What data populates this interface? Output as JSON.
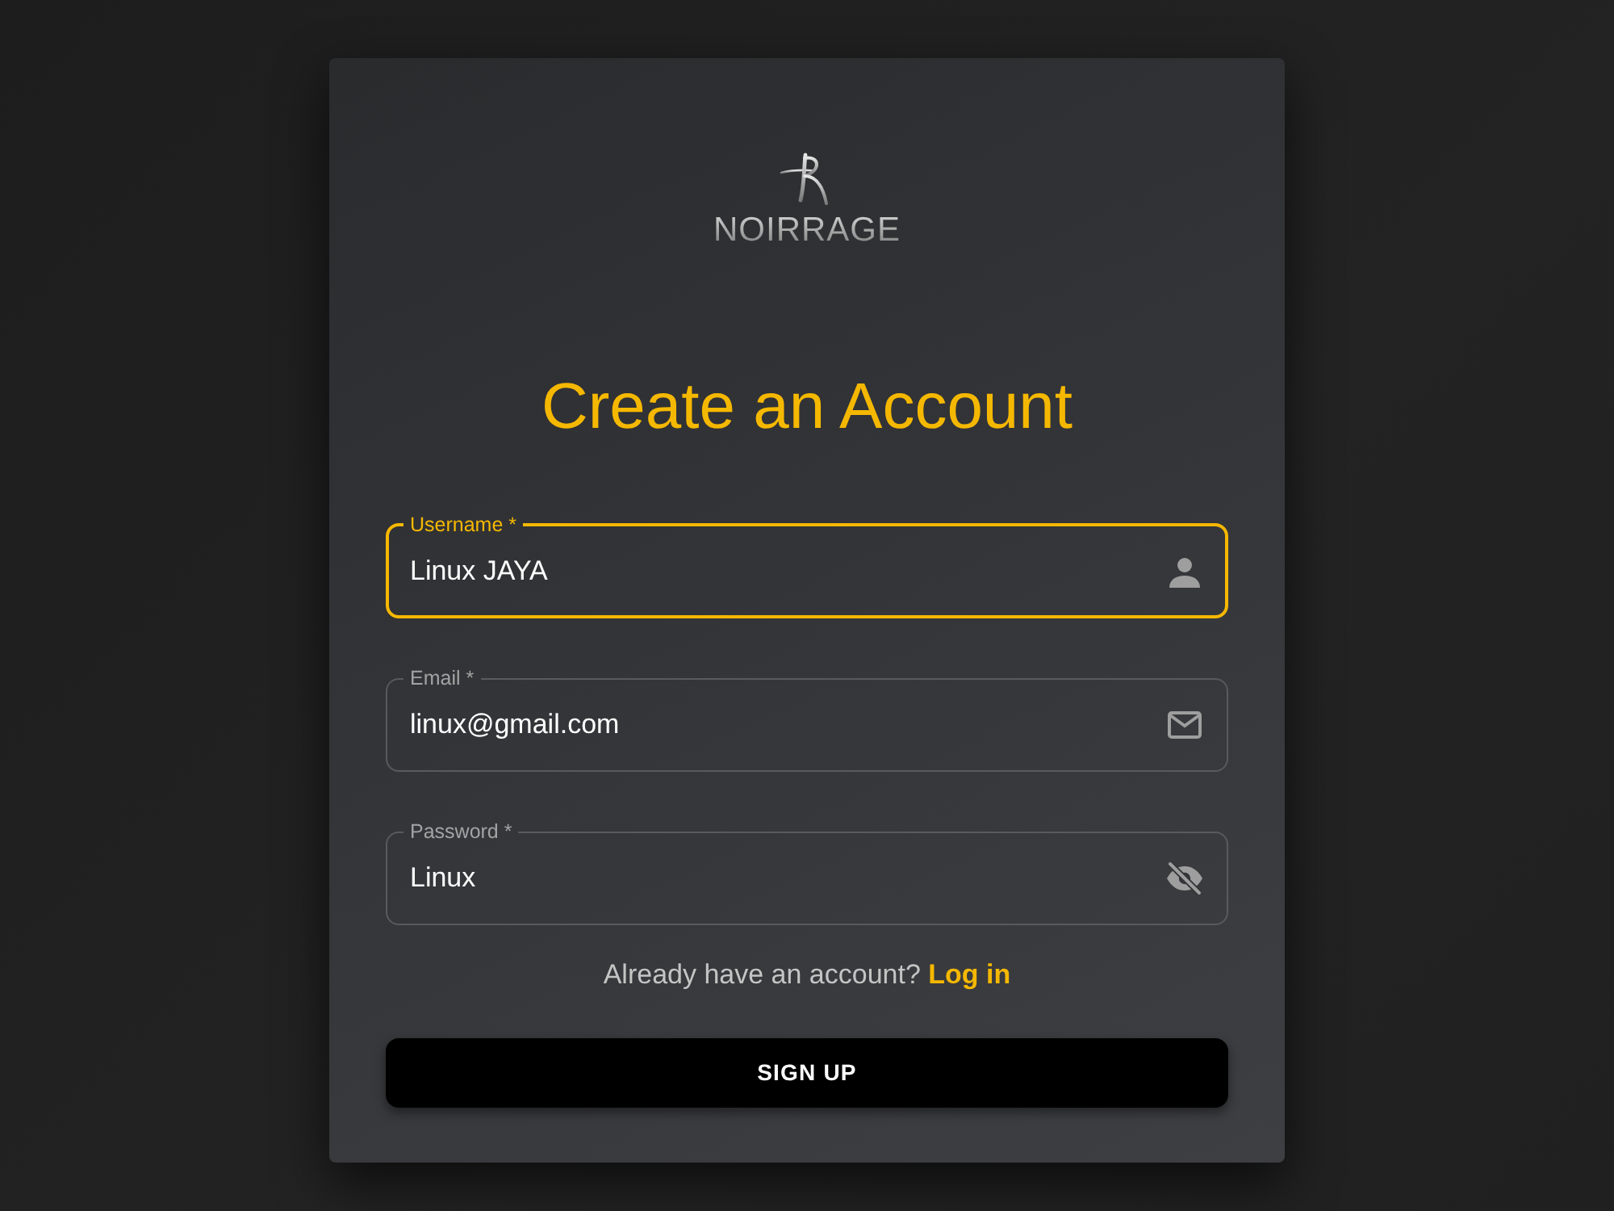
{
  "logo": {
    "text": "NOIRRAGE"
  },
  "title": "Create an Account",
  "fields": [
    {
      "kind": "username",
      "label": "Username *",
      "value": "Linux JAYA",
      "focused": true
    },
    {
      "kind": "email",
      "label": "Email *",
      "value": "linux@gmail.com",
      "focused": false
    },
    {
      "kind": "password",
      "label": "Password *",
      "value": "Linux",
      "focused": false
    }
  ],
  "login_prompt": {
    "text": "Already have an account?",
    "link": "Log in"
  },
  "submit_button": "SIGN UP"
}
